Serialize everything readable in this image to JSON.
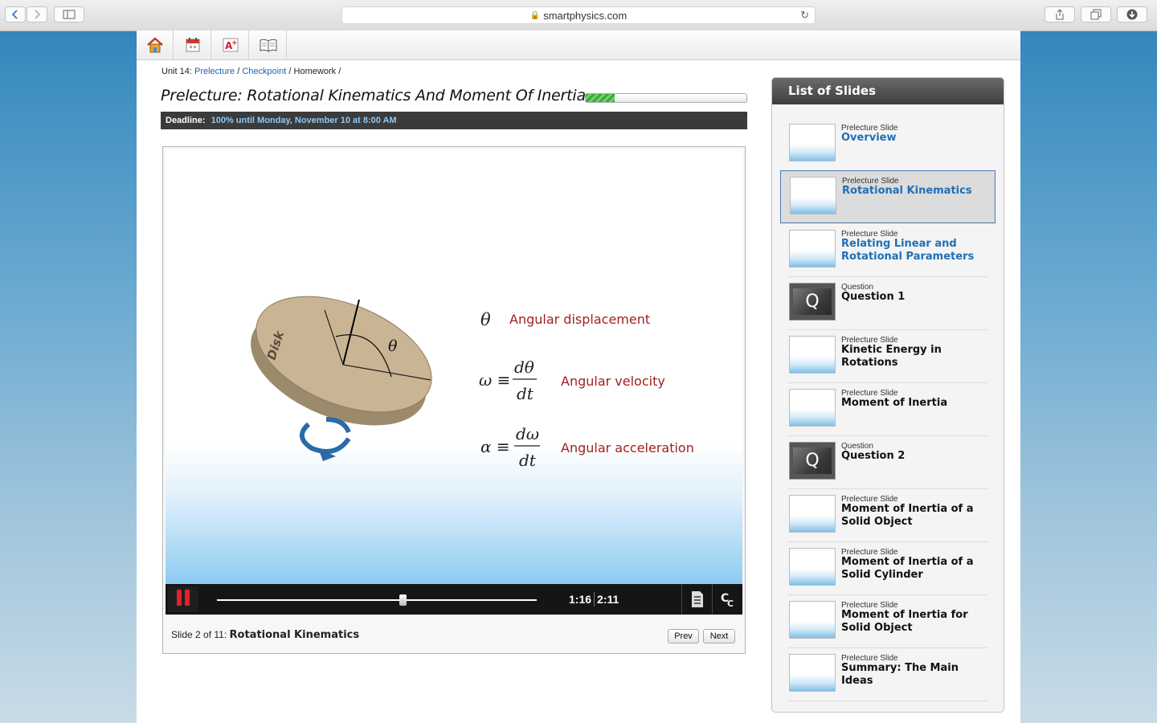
{
  "browser": {
    "url": "smartphysics.com",
    "back_icon": "chevron-left-icon",
    "forward_icon": "chevron-right-icon"
  },
  "toolbar": {
    "items": [
      "home-icon",
      "calendar-icon",
      "grades-icon",
      "book-icon"
    ]
  },
  "breadcrumb": {
    "unit": "Unit 14:",
    "prelecture": "Prelecture",
    "checkpoint": "Checkpoint",
    "homework": "Homework",
    "sep": "/"
  },
  "page": {
    "title": "Prelecture: Rotational Kinematics And Moment Of Inertia",
    "progress_fraction": 0.18,
    "deadline_label": "Deadline:",
    "deadline_value": "100% until Monday, November 10 at 8:00 AM"
  },
  "slide": {
    "disk_label": "Disk",
    "theta": "θ",
    "eq1_symbol": "θ",
    "eq1_label": "Angular displacement",
    "eq2_lhs": "ω ≡",
    "eq2_num": "dθ",
    "eq2_den": "dt",
    "eq2_label": "Angular velocity",
    "eq3_lhs": "α ≡",
    "eq3_num": "dω",
    "eq3_den": "dt",
    "eq3_label": "Angular acceleration"
  },
  "player": {
    "current_time": "1:16",
    "total_time": "2:11",
    "progress_fraction": 0.58,
    "slide_prefix": "Slide 2 of 11:",
    "slide_title": "Rotational Kinematics",
    "prev_label": "Prev",
    "next_label": "Next",
    "colors": {
      "accent_red": "#e0232a",
      "equation_label": "#a3201f"
    }
  },
  "slides_panel": {
    "title": "List of Slides",
    "items": [
      {
        "kind": "Prelecture Slide",
        "title": "Overview",
        "link": true,
        "thumb": "slide"
      },
      {
        "kind": "Prelecture Slide",
        "title": "Rotational Kinematics",
        "link": true,
        "selected": true,
        "thumb": "slide"
      },
      {
        "kind": "Prelecture Slide",
        "title": "Relating Linear and Rotational Parameters",
        "link": true,
        "thumb": "slide"
      },
      {
        "kind": "Question",
        "title": "Question 1",
        "thumb": "question",
        "q": "Q"
      },
      {
        "kind": "Prelecture Slide",
        "title": "Kinetic Energy in Rotations",
        "thumb": "slide"
      },
      {
        "kind": "Prelecture Slide",
        "title": "Moment of Inertia",
        "thumb": "slide"
      },
      {
        "kind": "Question",
        "title": "Question 2",
        "thumb": "question",
        "q": "Q"
      },
      {
        "kind": "Prelecture Slide",
        "title": "Moment of Inertia of a Solid Object",
        "thumb": "slide"
      },
      {
        "kind": "Prelecture Slide",
        "title": "Moment of Inertia of a Solid Cylinder",
        "thumb": "slide"
      },
      {
        "kind": "Prelecture Slide",
        "title": "Moment of Inertia for Solid Object",
        "thumb": "slide"
      },
      {
        "kind": "Prelecture Slide",
        "title": "Summary: The Main Ideas",
        "thumb": "slide"
      }
    ]
  }
}
